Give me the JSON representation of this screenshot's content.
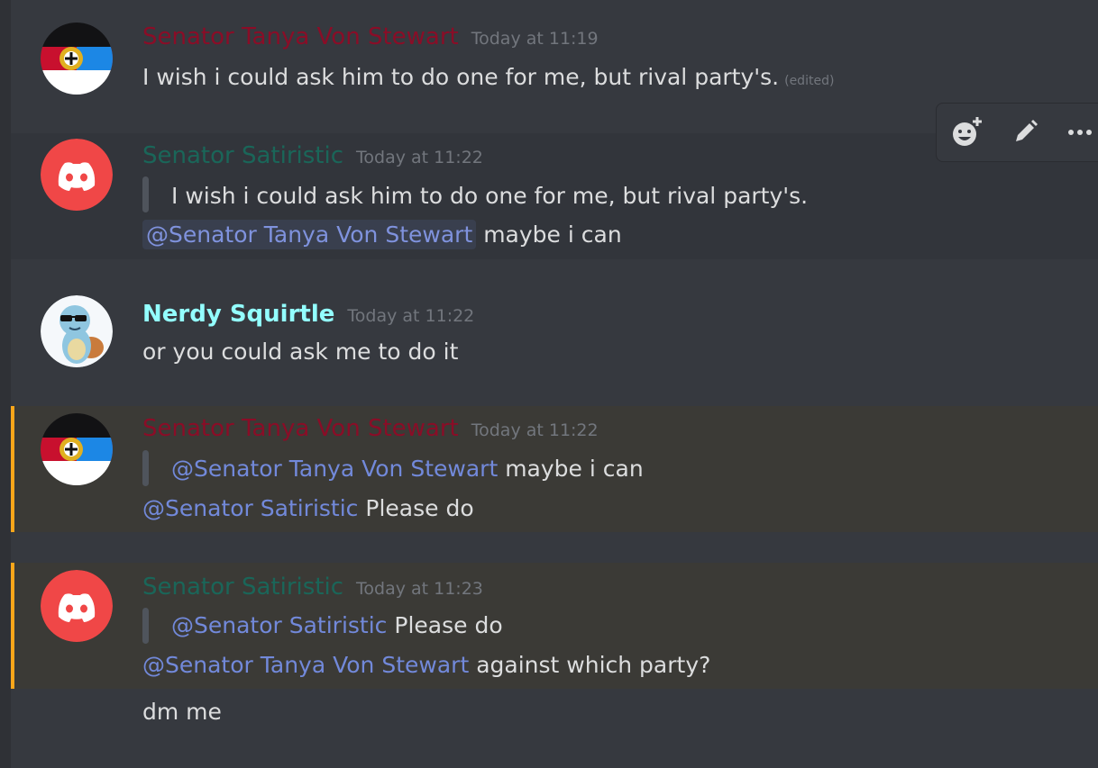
{
  "messages": [
    {
      "author": "Senator Tanya Von Stewart",
      "time": "Today at 11:19",
      "text": "I wish i could ask him to do one for me, but rival party's.",
      "edited": "(edited)"
    },
    {
      "author": "Senator Satiristic",
      "time": "Today at 11:22",
      "quote": "I wish i could ask him to do one for me, but rival party's.",
      "mention": "@Senator Tanya Von Stewart",
      "text": "maybe i can"
    },
    {
      "author": "Nerdy Squirtle",
      "time": "Today at 11:22",
      "text": "or you could ask me to do it"
    },
    {
      "author": "Senator Tanya Von Stewart",
      "time": "Today at 11:22",
      "quote_mention": "@Senator Tanya Von Stewart",
      "quote_text": "maybe i can",
      "mention": "@Senator Satiristic",
      "text": "Please do"
    },
    {
      "author": "Senator Satiristic",
      "time": "Today at 11:23",
      "quote_mention": "@Senator Satiristic",
      "quote_text": "Please do",
      "mention": "@Senator Tanya Von Stewart",
      "text": "against which party?",
      "followup": "dm me"
    }
  ],
  "toolbar": {
    "icons": [
      "add-reaction-icon",
      "edit-pencil-icon",
      "more-options-icon"
    ]
  },
  "colors": {
    "background": "#36393f",
    "mention_highlight_bar": "#faa61a",
    "mention_text": "#7289da",
    "tanya_role": "#8a0d27",
    "satiristic_role": "#1a6659",
    "nerdy_role": "#93ffff",
    "discord_red": "#f04747"
  }
}
